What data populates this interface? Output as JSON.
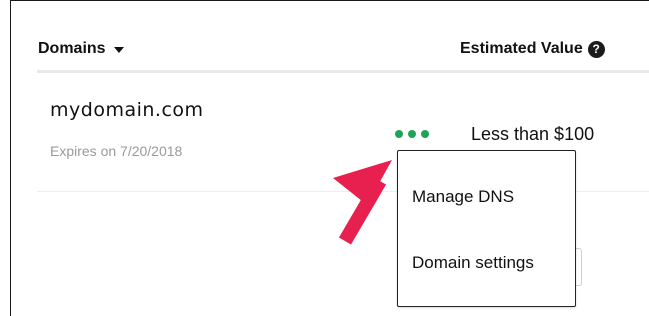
{
  "table": {
    "domains_header": "Domains",
    "value_header": "Estimated Value",
    "help_glyph": "?"
  },
  "row": {
    "domain": "mydomain.com",
    "expiry": "Expires on 7/20/2018",
    "estimated_value": "Less than $100"
  },
  "menu": {
    "items": [
      {
        "label": "Manage DNS"
      },
      {
        "label": "Domain settings"
      }
    ]
  },
  "icons": {
    "sort": "caret-down-icon",
    "help": "question-circle-icon",
    "more": "more-dots-icon",
    "annotation": "arrow-annotation-icon"
  },
  "colors": {
    "accent_green": "#1ea35a",
    "annotation_red": "#e8204f",
    "text": "#111111",
    "muted_text": "#9a9a9a"
  }
}
